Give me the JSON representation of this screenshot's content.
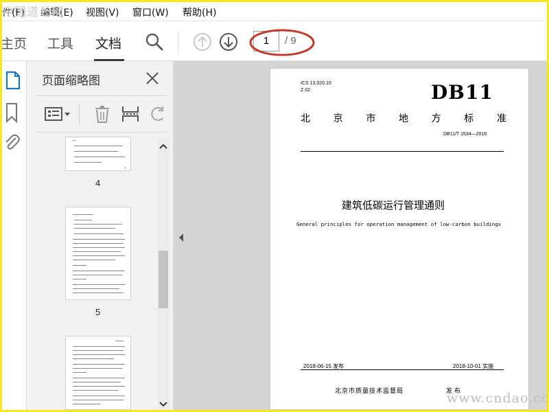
{
  "watermark_top": "中国道长网",
  "watermark_bottom": "www.cndao.com",
  "menu": {
    "file": "件(F)",
    "edit": "编辑(E)",
    "view": "视图(V)",
    "window": "窗口(W)",
    "help": "帮助(H)"
  },
  "toolbar": {
    "tab_home": "主页",
    "tab_tools": "工具",
    "tab_document": "文档",
    "current_page": "1",
    "total_pages": "/ 9"
  },
  "thumbnail_panel": {
    "title": "页面缩略图",
    "pages": [
      {
        "number": "4"
      },
      {
        "number": "5"
      }
    ]
  },
  "document": {
    "ics": "ICS 13.020.10",
    "z": "Z 02",
    "db": "DB11",
    "standard_chars": [
      "北",
      "京",
      "市",
      "地",
      "方",
      "标",
      "准"
    ],
    "code": "DB11/T 1534—2018",
    "title_cn": "建筑低碳运行管理通则",
    "title_en": "General principles for operation management of low-carbon buildings",
    "publish_date": "2018-06-15 发布",
    "implement_date": "2018-10-01 实施",
    "issuer": "北京市质量技术监督局",
    "issue_label": "发布"
  },
  "colors": {
    "frame_border": "#f8e71c",
    "highlight_ellipse": "#c0392b",
    "viewer_bg": "#d4d4d4",
    "panel_bg": "#f1f1f1"
  },
  "icons": [
    "search-icon",
    "page-up-icon",
    "page-down-icon",
    "page-thumbnails-icon",
    "bookmark-icon",
    "attachment-icon",
    "close-icon",
    "thumbnail-options-icon",
    "delete-icon",
    "extract-icon",
    "undo-icon",
    "scroll-up-icon",
    "scroll-down-icon",
    "collapse-panel-icon"
  ]
}
